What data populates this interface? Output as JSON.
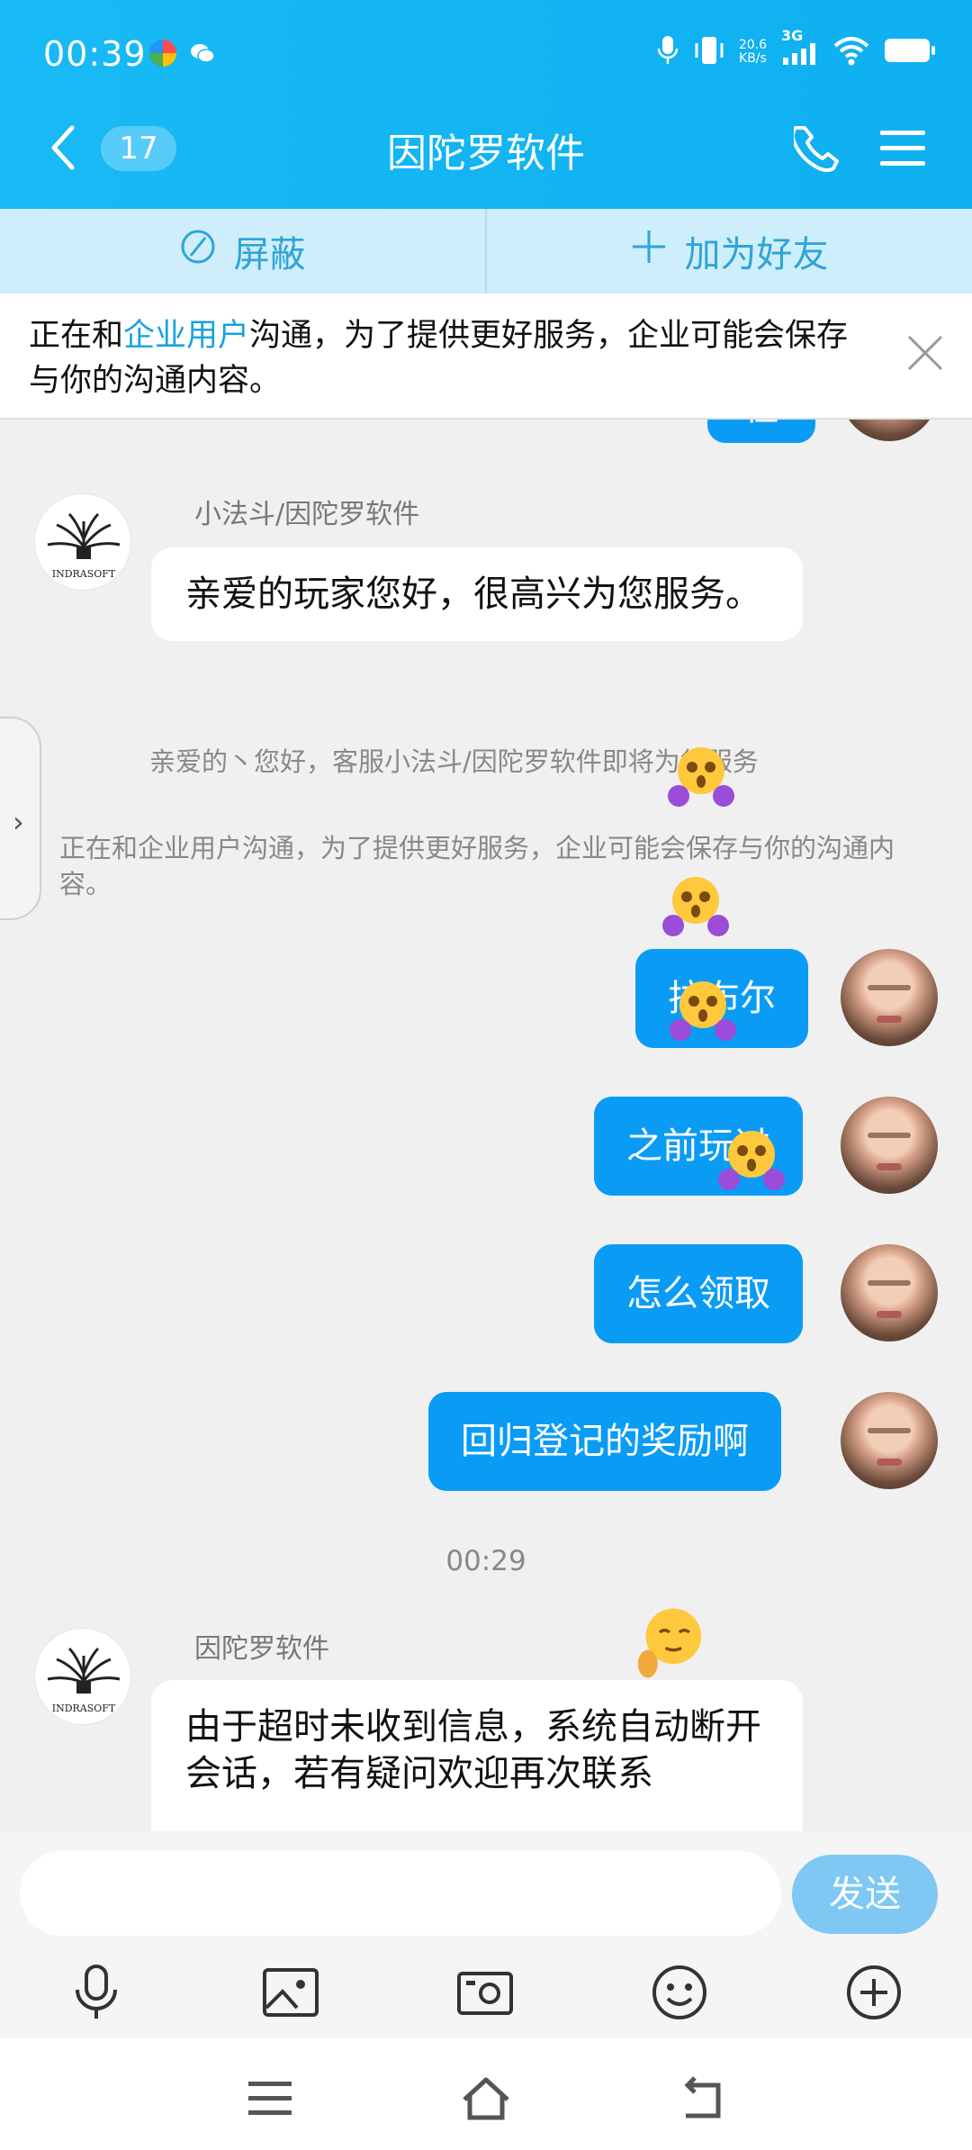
{
  "status_bar": {
    "time": "00:39",
    "net_speed_value": "20.6",
    "net_speed_unit": "KB/s",
    "signal": "3G",
    "battery": "100%"
  },
  "header": {
    "unread_count": "17",
    "title": "因陀罗软件",
    "background": "#19baf5"
  },
  "actions": {
    "block_label": "屏蔽",
    "add_friend_label": "加为好友"
  },
  "notice": {
    "text_before": "正在和",
    "highlight": "企业用户",
    "text_after": "沟通，为了提供更好服务，企业可能会保存与你的沟通内容。"
  },
  "chat": {
    "partial_top_bubble": "在",
    "messages": [
      {
        "from": "kf",
        "sender": "小法斗/因陀罗软件",
        "text": "亲爱的玩家您好，很高兴为您服务。"
      },
      {
        "from": "system",
        "text": "亲爱的丶您好，客服小法斗/因陀罗软件即将为您服务"
      },
      {
        "from": "system",
        "text": "正在和企业用户沟通，为了提供更好服务，企业可能会保存与你的沟通内容。"
      },
      {
        "from": "me",
        "text": "拉布尔"
      },
      {
        "from": "me",
        "text": "之前玩过"
      },
      {
        "from": "me",
        "text": "怎么领取"
      },
      {
        "from": "me",
        "text": "回归登记的奖励啊"
      },
      {
        "from": "time",
        "text": "00:29"
      },
      {
        "from": "kf",
        "sender": "因陀罗软件",
        "text": "由于超时未收到信息，系统自动断开会话，若有疑问欢迎再次联系"
      }
    ],
    "avatar_logo_text": "INDRASOFT"
  },
  "input": {
    "placeholder": "",
    "send_label": "发送"
  },
  "toolbar": {
    "icons": [
      "microphone-icon",
      "image-icon",
      "camera-icon",
      "emoji-icon",
      "plus-icon"
    ]
  },
  "colors": {
    "accent": "#0a9cf5",
    "action_bar": "#cdeefa",
    "highlight": "#19a3dc",
    "send_button": "#7ec8f3"
  }
}
